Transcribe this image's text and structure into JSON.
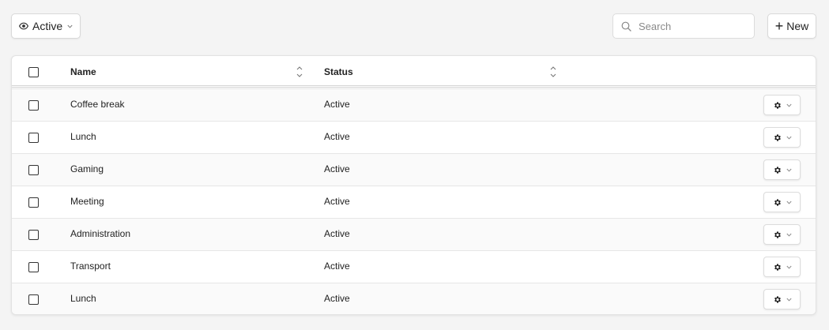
{
  "toolbar": {
    "filter_label": "Active",
    "search_placeholder": "Search",
    "new_label": "New"
  },
  "table": {
    "columns": [
      "Name",
      "Status"
    ],
    "rows": [
      {
        "name": "Coffee break",
        "status": "Active"
      },
      {
        "name": "Lunch",
        "status": "Active"
      },
      {
        "name": "Gaming",
        "status": "Active"
      },
      {
        "name": "Meeting",
        "status": "Active"
      },
      {
        "name": "Administration",
        "status": "Active"
      },
      {
        "name": "Transport",
        "status": "Active"
      },
      {
        "name": "Lunch",
        "status": "Active"
      }
    ]
  },
  "icons": {
    "filter": "eye-icon",
    "filter_dropdown": "chevron-down-icon",
    "search": "search-icon",
    "new": "plus-icon",
    "sort": "sort-icon",
    "row_action": "gear-icon",
    "row_action_dropdown": "chevron-down-icon"
  },
  "colors": {
    "background": "#f4f4f4",
    "card": "#ffffff",
    "row_alt": "#fafafa",
    "border": "#e2e2e2",
    "text": "#222222"
  }
}
